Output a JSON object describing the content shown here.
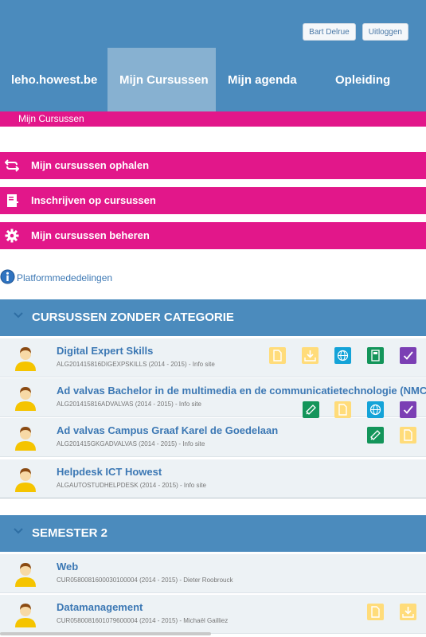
{
  "header": {
    "user_button": "Bart Delrue",
    "logout_button": "Uitloggen",
    "nav": {
      "brand": "leho.howest.be",
      "mijn_cursussen": "Mijn Cursussen",
      "mijn_agenda": "Mijn agenda",
      "opleiding": "Opleiding"
    }
  },
  "breadcrumb": "Mijn Cursussen",
  "actions": {
    "ophalen": "Mijn cursussen ophalen",
    "inschrijven": "Inschrijven op cursussen",
    "beheren": "Mijn cursussen beheren"
  },
  "announcements": "Platformmededelingen",
  "categories": [
    {
      "title": "CURSUSSEN ZONDER CATEGORIE",
      "courses": [
        {
          "title": "Digital Expert Skills",
          "meta": "ALG201415816DIGEXPSKILLS (2014 - 2015) - Info site",
          "tools": [
            "document-icon",
            "download-icon",
            "globe-icon",
            "calculator-icon",
            "checkbox-icon"
          ]
        },
        {
          "title": "Ad valvas Bachelor in de multimedia en de communicatietechnologie (NMCT)",
          "meta": "ALG201415816ADVALVAS (2014 - 2015) - Info site",
          "tools": [
            "announce-icon",
            "document-icon",
            "globe-icon",
            "checkbox-icon"
          ]
        },
        {
          "title": "Ad valvas Campus Graaf Karel de Goedelaan",
          "meta": "ALG201415GKGADVALVAS (2014 - 2015) - Info site",
          "tools": [
            "announce-icon",
            "document-icon"
          ]
        },
        {
          "title": "Helpdesk ICT Howest",
          "meta": "ALGAUTOSTUDHELPDESK (2014 - 2015) - Info site",
          "tools": []
        }
      ]
    },
    {
      "title": "SEMESTER 2",
      "courses": [
        {
          "title": "Web",
          "meta": "CUR0580081600030100004 (2014 - 2015) - Dieter Roobrouck",
          "tools": []
        },
        {
          "title": "Datamanagement",
          "meta": "CUR0580081601079600004 (2014 - 2015) - Michaël Gailliez",
          "tools": [
            "document-icon",
            "download-icon"
          ]
        }
      ]
    }
  ],
  "colors": {
    "header_blue": "#4b8bbd",
    "active_tab": "#87b1d1",
    "magenta": "#e2178a",
    "link_blue": "#3c78b4",
    "row_bg": "#edf2f5"
  }
}
